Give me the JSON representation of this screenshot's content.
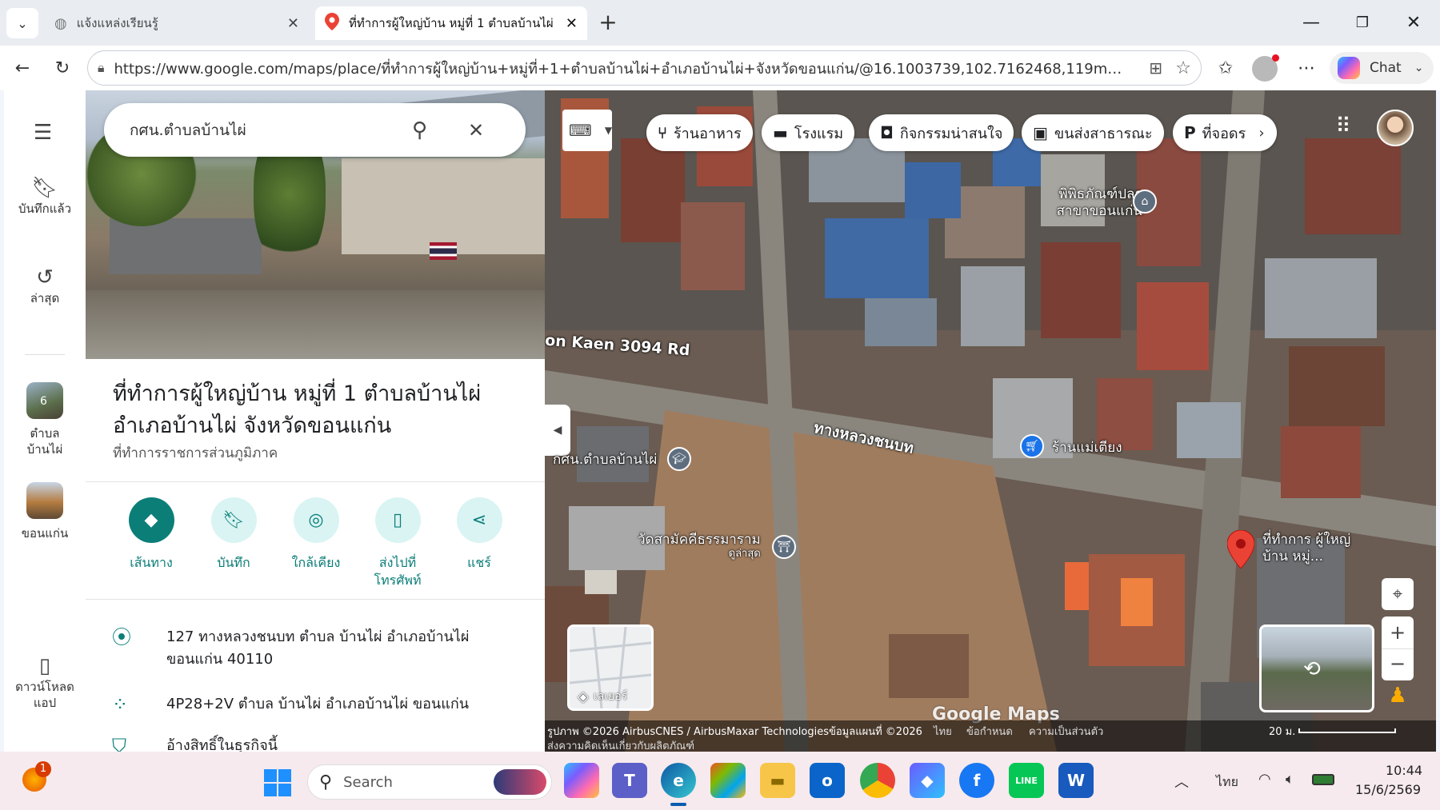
{
  "browser": {
    "tabs": [
      {
        "label": "แจ้งแหล่งเรียนรู้",
        "active": false
      },
      {
        "label": "ที่ทำการผู้ใหญ่บ้าน หมู่ที่ 1 ตำบลบ้านไผ่",
        "active": true
      }
    ],
    "url": "https://www.google.com/maps/place/ที่ทำการผู้ใหญ่บ้าน+หมู่ที่+1+ตำบลบ้านไผ่+อำเภอบ้านไผ่+จังหวัดขอนแก่น/@16.1003739,102.7162468,119m/data=...",
    "copilot_label": "Chat"
  },
  "rail": {
    "saved": "บันทึกแล้ว",
    "recent": "ล่าสุด",
    "place1": "ตำบล บ้านไผ่",
    "place1_badge": "6",
    "place2": "ขอนแก่น",
    "download": "ดาวน์โหลด แอป"
  },
  "panel": {
    "search_value": "กศน.ตำบลบ้านไผ่",
    "title": "ที่ทำการผู้ใหญ่บ้าน หมู่ที่ 1 ตำบลบ้านไผ่ อำเภอบ้านไผ่ จังหวัดขอนแก่น",
    "category": "ที่ทำการราชการส่วนภูมิภาค",
    "actions": [
      {
        "label": "เส้นทาง"
      },
      {
        "label": "บันทึก"
      },
      {
        "label": "ใกล้เคียง"
      },
      {
        "label": "ส่งไปที่ โทรศัพท์"
      },
      {
        "label": "แชร์"
      }
    ],
    "address": "127 ทางหลวงชนบท ตำบล บ้านไผ่ อำเภอบ้านไผ่ ขอนแก่น 40110",
    "plus_code": "4P28+2V ตำบล บ้านไผ่ อำเภอบ้านไผ่ ขอนแก่น",
    "claim": "อ้างสิทธิ์ในธุรกิจนี้"
  },
  "map": {
    "chips": [
      "ร้านอาหาร",
      "โรงแรม",
      "กิจกรรมน่าสนใจ",
      "ขนส่งสาธารณะ",
      "ที่จอดร"
    ],
    "labels": {
      "museum": "พิพิธภัณฑ์ปลา สาขาขอนแก่น",
      "road_en": "on Kaen 3094 Rd",
      "road_th": "ทางหลวงชนบท",
      "school": "กศน.ตำบลบ้านไผ่",
      "shop": "ร้านแม่เตียง",
      "temple": "วัดสามัคคีธรรมาราม",
      "temple_sub": "ดูล่าสุด",
      "place": "ที่ทำการ ผู้ใหญ่บ้าน หมู่..."
    },
    "layers_label": "เลเยอร์",
    "footer_copyright": "รูปภาพ ©2026 AirbusCNES / AirbusMaxar Technologiesข้อมูลแผนที่ ©2026",
    "footer_lang": "ไทย",
    "footer_terms": "ข้อกำหนด",
    "footer_privacy": "ความเป็นส่วนตัว",
    "footer_feedback": "ส่งความคิดเห็นเกี่ยวกับผลิตภัณฑ์",
    "scale": "20 ม.",
    "watermark": "Google Maps"
  },
  "taskbar": {
    "search_placeholder": "Search",
    "notification_count": "1",
    "lang": "ไทย",
    "time": "10:44",
    "date": "15/6/2569"
  },
  "colors": {
    "accent": "#0b7e78",
    "pin": "#ea4335",
    "taskbar": "#f6eaee"
  }
}
